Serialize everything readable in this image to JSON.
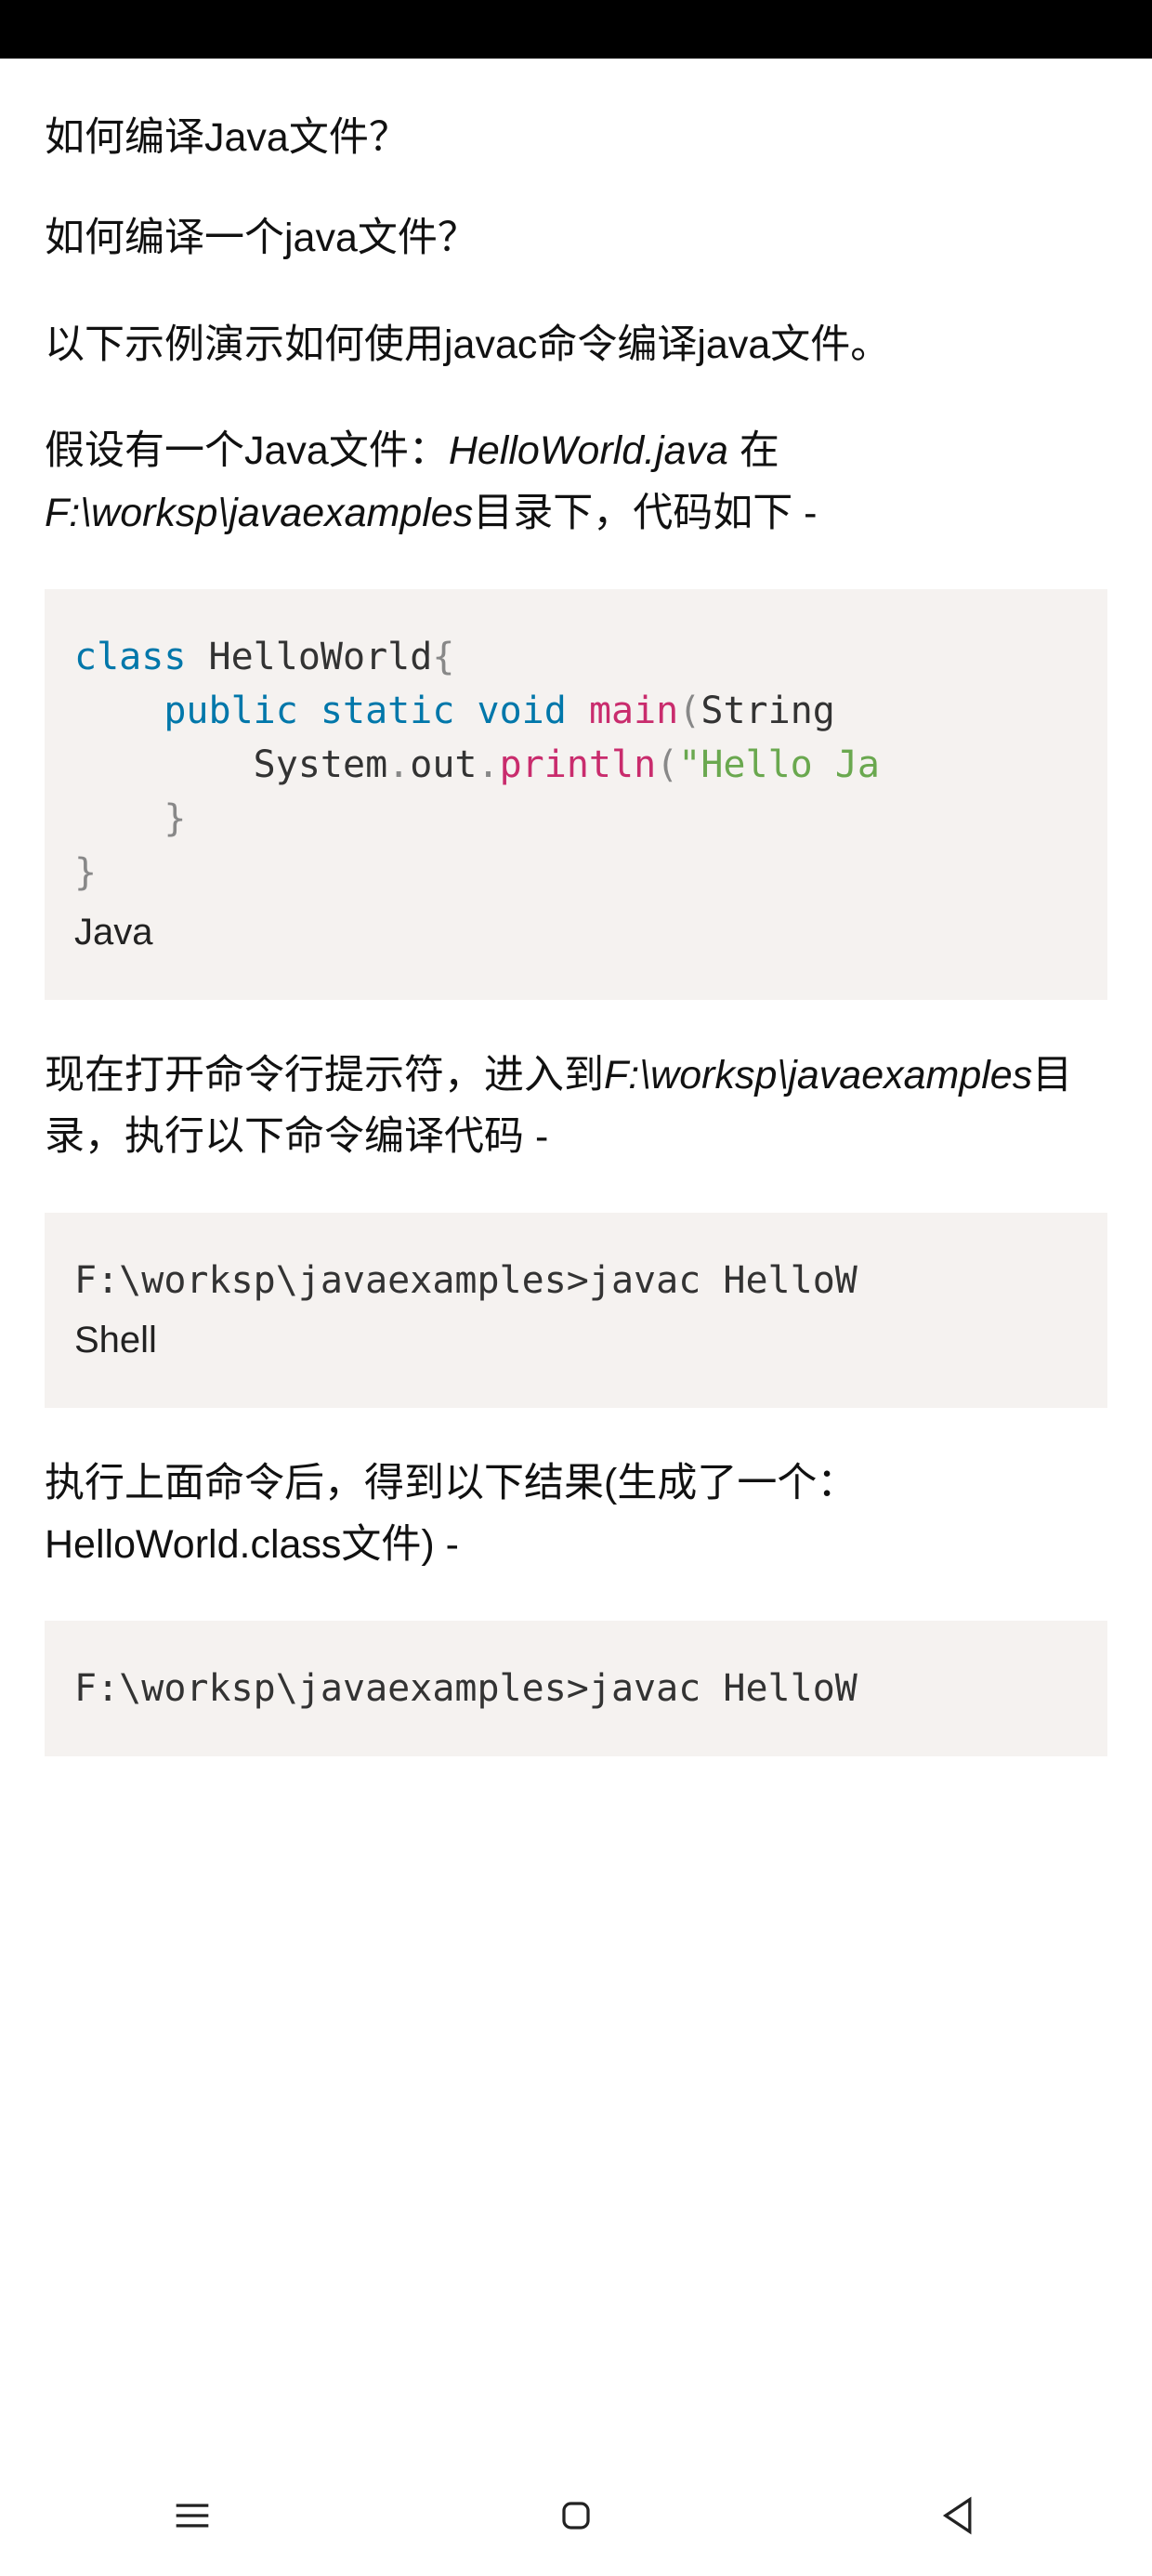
{
  "title": "如何编译Java文件？",
  "p1": "如何编译一个java文件？",
  "p2": "以下示例演示如何使用javac命令编译java文件。",
  "p3_a": "假设有一个Java文件：",
  "p3_file": "HelloWorld.java",
  "p3_b": " 在 ",
  "p3_dir": "F:\\worksp\\javaexamples",
  "p3_c": "目录下，代码如下 -",
  "code1": {
    "kw_class": "class",
    "classname": " HelloWorld",
    "kw_public": "public",
    "kw_static": "static",
    "kw_void": "void",
    "fn_main": "main",
    "arg_string": "String ",
    "sys": "System",
    "out": "out",
    "fn_println": "println",
    "str": "\"Hello Ja",
    "label": "Java"
  },
  "p4_a": "现在打开命令行提示符，进入到",
  "p4_dir": "F:\\worksp\\javaexamples",
  "p4_b": "目录，执行以下命令编译代码 -",
  "code2": {
    "line": "F:\\worksp\\javaexamples>javac HelloW",
    "label": "Shell"
  },
  "p5": "执行上面命令后，得到以下结果(生成了一个：HelloWorld.class文件) -",
  "code3": {
    "line": "F:\\worksp\\javaexamples>javac HelloW"
  }
}
